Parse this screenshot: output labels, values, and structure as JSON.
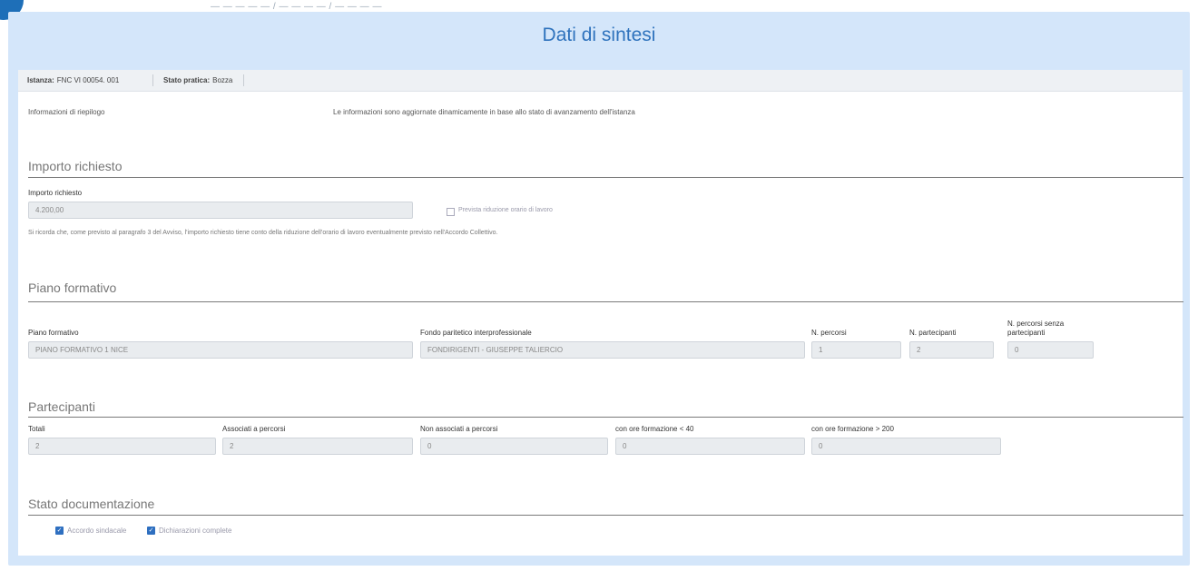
{
  "header": {
    "breadcrumb": "— — — — —   /   — — — —   /   — — — —",
    "title": "Dati di sintesi"
  },
  "info_bar": {
    "istanza_label": "Istanza:",
    "istanza_value": "FNC VI 00054. 001",
    "stato_label": "Stato pratica:",
    "stato_value": "Bozza"
  },
  "riepilogo": {
    "label": "Informazioni di riepilogo",
    "text": "Le informazioni sono aggiornate dinamicamente in base allo stato di avanzamento dell'istanza"
  },
  "importo": {
    "section_title": "Importo richiesto",
    "field_label": "Importo richiesto",
    "field_value": "4.200,00",
    "checkbox_label": "Prevista riduzione orario di lavoro",
    "note": "Si ricorda che, come previsto al paragrafo 3 del Avviso, l'importo richiesto tiene conto della riduzione dell'orario di lavoro eventualmente previsto nell'Accordo Collettivo."
  },
  "piano": {
    "section_title": "Piano formativo",
    "piano_label": "Piano formativo",
    "piano_value": "PIANO FORMATIVO 1 NICE",
    "fondo_label": "Fondo paritetico interprofessionale",
    "fondo_value": "FONDIRIGENTI - GIUSEPPE TALIERCIO",
    "percorsi_label": "N. percorsi",
    "percorsi_value": "1",
    "partecipanti_label": "N. partecipanti",
    "partecipanti_value": "2",
    "senza_label_1": "N. percorsi senza",
    "senza_label_2": "partecipanti",
    "senza_value": "0"
  },
  "partecipanti": {
    "section_title": "Partecipanti",
    "totali_label": "Totali",
    "totali_value": "2",
    "associati_label": "Associati a percorsi",
    "associati_value": "2",
    "non_associati_label": "Non associati a percorsi",
    "non_associati_value": "0",
    "ore_40_label": "con ore formazione < 40",
    "ore_40_value": "0",
    "ore_200_label": "con ore formazione > 200",
    "ore_200_value": "0"
  },
  "documentazione": {
    "section_title": "Stato documentazione",
    "check1_label": "Accordo sindacale",
    "check2_label": "Dichiarazioni complete"
  },
  "colors": {
    "accent": "#2f73bd",
    "panel_bg": "#d4e6fa",
    "checkbox": "#2e6fc0"
  }
}
